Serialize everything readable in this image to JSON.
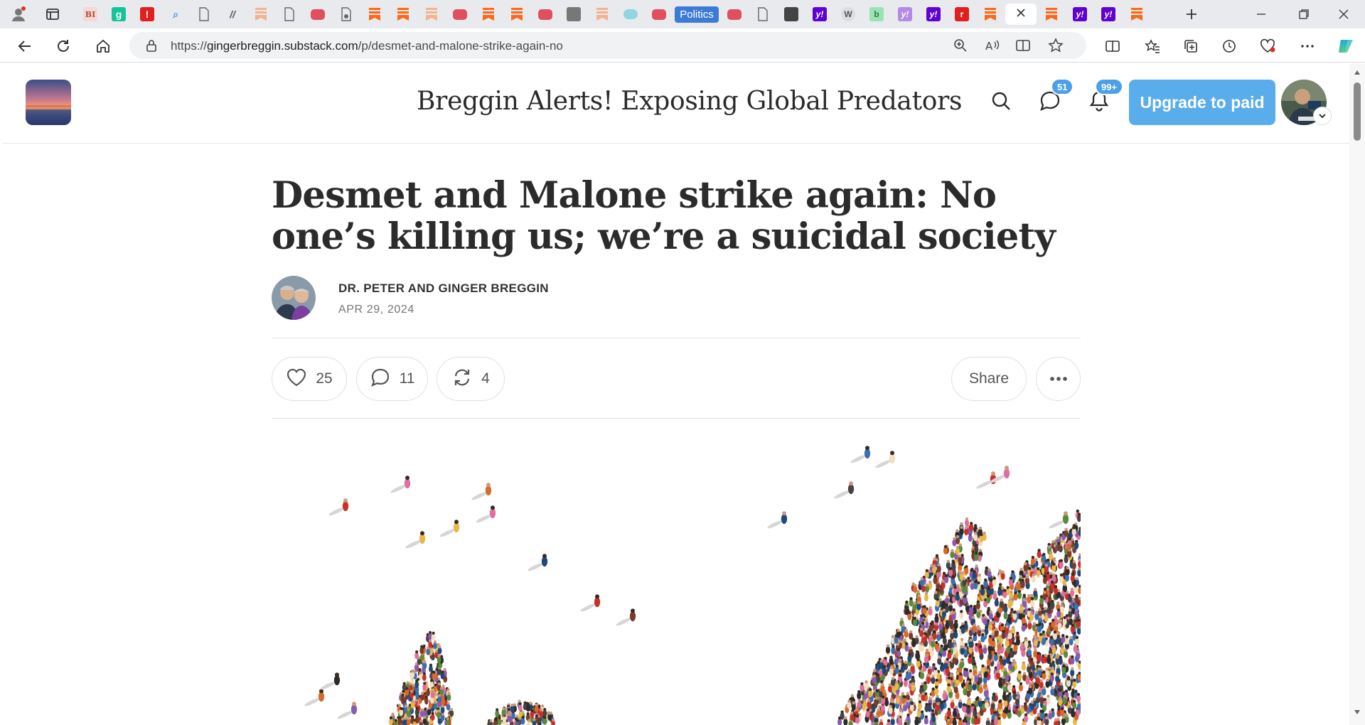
{
  "browser": {
    "tab_group_label": "Politics",
    "url": {
      "scheme": "https://",
      "host": "gingerbreggin.substack.com",
      "path": "/p/desmet-and-malone-strike-again-no"
    }
  },
  "header": {
    "site_title": "Breggin Alerts! Exposing Global Predators",
    "chat_badge": "51",
    "notification_badge": "99+",
    "upgrade_label": "Upgrade to paid"
  },
  "post": {
    "title": "Desmet and Malone strike again: No one’s killing us; we’re a suicidal society",
    "author": "DR. PETER AND GINGER BREGGIN",
    "date": "APR 29, 2024",
    "likes": "25",
    "comments": "11",
    "restacks": "4",
    "share_label": "Share"
  },
  "colors": {
    "accent": "#5aadeb",
    "badge": "#4ba0e8",
    "tab_group": "#3b7bd6",
    "substack_orange": "#ff6719"
  }
}
